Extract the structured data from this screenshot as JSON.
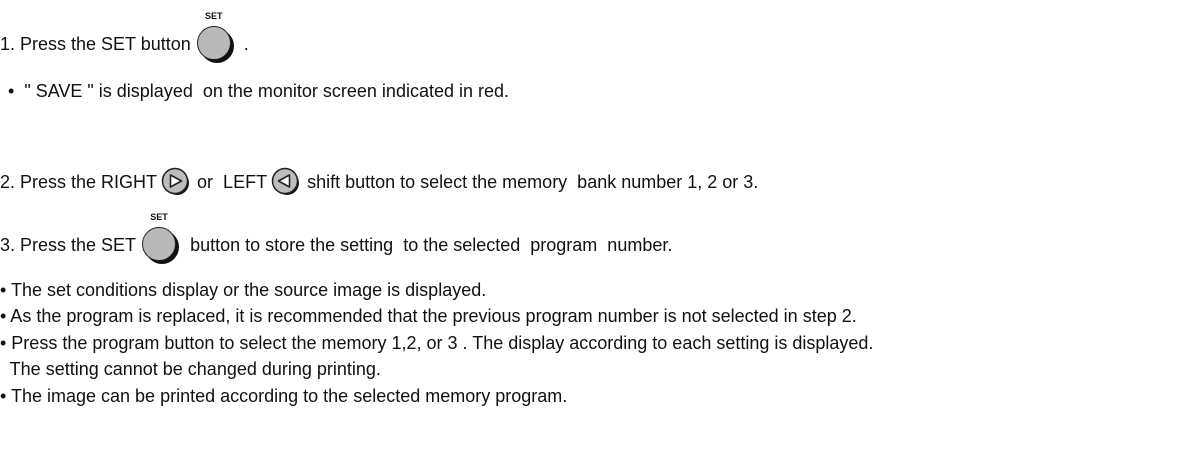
{
  "step1": {
    "prefix": "1. Press the SET button",
    "button_label": "SET",
    "suffix": " ."
  },
  "bullet1": {
    "marker": "•",
    "text": "  \" SAVE \" is displayed  on the monitor screen indicated in red."
  },
  "step2": {
    "prefix": "2. Press the RIGHT",
    "middle": "or  LEFT",
    "suffix": "shift button to select the memory  bank number 1, 2 or 3."
  },
  "step3": {
    "prefix": "3. Press the SET",
    "button_label": "SET",
    "suffix": "button to store the setting  to the selected  program  number."
  },
  "notes": [
    "• The set conditions display or the source image is displayed.",
    "• As the program is replaced, it is recommended that the previous program number is not selected in step 2.",
    "• Press the program button to select the memory 1,2, or 3 . The display according to each setting is displayed.",
    "  The setting cannot be changed during printing.",
    "• The image can be printed according to the selected memory program."
  ],
  "icons": {
    "set_button": "round-set-button-icon",
    "right_button": "right-shift-button-icon",
    "left_button": "left-shift-button-icon"
  }
}
